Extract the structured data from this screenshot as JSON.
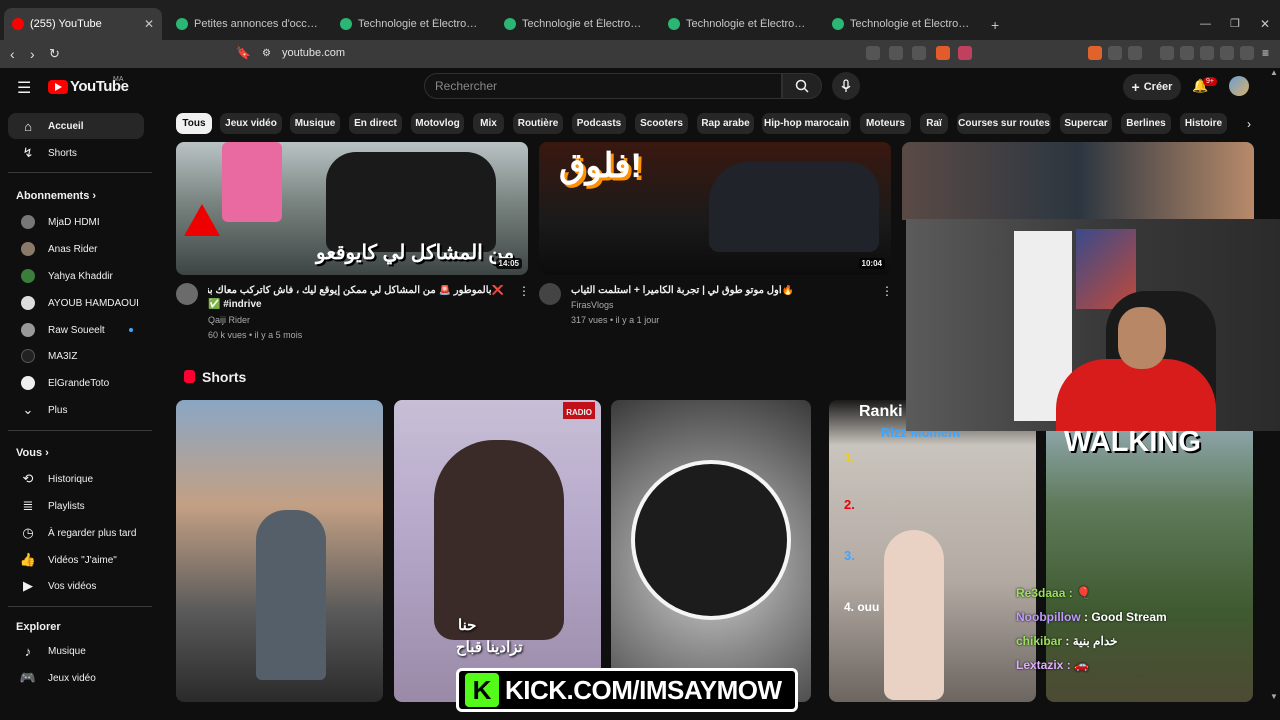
{
  "browser": {
    "tabs": [
      {
        "label": "(255) YouTube",
        "active": true
      },
      {
        "label": "Petites annonces d'occasion, gratuite",
        "active": false
      },
      {
        "label": "Technologie et Électronique d'Occasi",
        "active": false
      },
      {
        "label": "Technologie et Électronique d'Occasi",
        "active": false
      },
      {
        "label": "Technologie et Électronique d'Occasi",
        "active": false
      },
      {
        "label": "Technologie et Électronique d'Occas",
        "active": false
      }
    ],
    "url": "youtube.com"
  },
  "header": {
    "logo": "YouTube",
    "country_code": "MA",
    "search_placeholder": "Rechercher",
    "create_label": "Créer",
    "notification_count": "9+"
  },
  "chips": [
    "Tous",
    "Jeux vidéo",
    "Musique",
    "En direct",
    "Motovlog",
    "Mix",
    "Routière",
    "Podcasts",
    "Scooters",
    "Rap arabe",
    "Hip-hop marocain",
    "Moteurs",
    "Raï",
    "Courses sur routes",
    "Supercar",
    "Berlines",
    "Histoire"
  ],
  "sidebar": {
    "main": [
      {
        "label": "Accueil",
        "icon": "home-icon"
      },
      {
        "label": "Shorts",
        "icon": "shorts-icon"
      }
    ],
    "subscriptions_title": "Abonnements",
    "subscriptions": [
      {
        "label": "MjaD HDMI"
      },
      {
        "label": "Anas Rider"
      },
      {
        "label": "Yahya Khaddir"
      },
      {
        "label": "AYOUB HAMDAOUI"
      },
      {
        "label": "Raw Soueelt"
      },
      {
        "label": "MA3IZ"
      },
      {
        "label": "ElGrandeToto"
      },
      {
        "label": "Plus"
      }
    ],
    "you_title": "Vous",
    "you": [
      {
        "label": "Historique"
      },
      {
        "label": "Playlists"
      },
      {
        "label": "À regarder plus tard"
      },
      {
        "label": "Vidéos \"J'aime\""
      },
      {
        "label": "Vos vidéos"
      }
    ],
    "explore_title": "Explorer",
    "explore": [
      {
        "label": "Musique"
      },
      {
        "label": "Jeux vidéo"
      }
    ]
  },
  "videos": [
    {
      "thumb_text": "من المشاكل لي كايوقعو",
      "duration": "14:05",
      "title_line1": "❌بالموطور 🚨 من المشاكل لي ممكن إيوقع ليك ، فاش كاتركب معاك بنت indrive",
      "title_line2": "✅ #indrive",
      "channel": "Qaiji Rider",
      "meta": "60 k vues • il y a 5 mois"
    },
    {
      "thumb_text": "فلوق!",
      "duration": "10:04",
      "title_line1": "🔥أول موتو طوق لي | تجربة الكاميرا + استلمت الثياب",
      "channel": "FirasVlogs",
      "meta": "317 vues • il y a 1 jour"
    }
  ],
  "shorts_section": {
    "title": "Shorts",
    "items": [
      {
        "caption": ""
      },
      {
        "caption_line1": "حنا",
        "caption_line2": "تزادينا قباح",
        "badge": "RADIO"
      },
      {
        "caption": ""
      },
      {
        "caption_line1": "Ranki",
        "caption_line2": "Rizz Moment",
        "list": [
          "1.",
          "2.",
          "3.",
          "4. ouu 😉"
        ]
      },
      {
        "caption": "WALKING"
      }
    ]
  },
  "overlay": {
    "kick_url": "KICK.COM/IMSAYMOW",
    "chat": [
      {
        "user": "Re3daaa",
        "msg": "🎈",
        "color": "#9be15d"
      },
      {
        "user": "Noobpillow",
        "msg": "Good Stream",
        "color": "#c09bff"
      },
      {
        "user": "chikibar",
        "msg": "خدام بنية",
        "color": "#9be15d"
      },
      {
        "user": "Lextazix",
        "msg": "🚗",
        "color": "#e0b0ff"
      }
    ]
  },
  "colors": {
    "bg": "#0f0f0f",
    "accent": "#ff0000",
    "kick_green": "#53fc18",
    "chip_bg": "#272727"
  }
}
